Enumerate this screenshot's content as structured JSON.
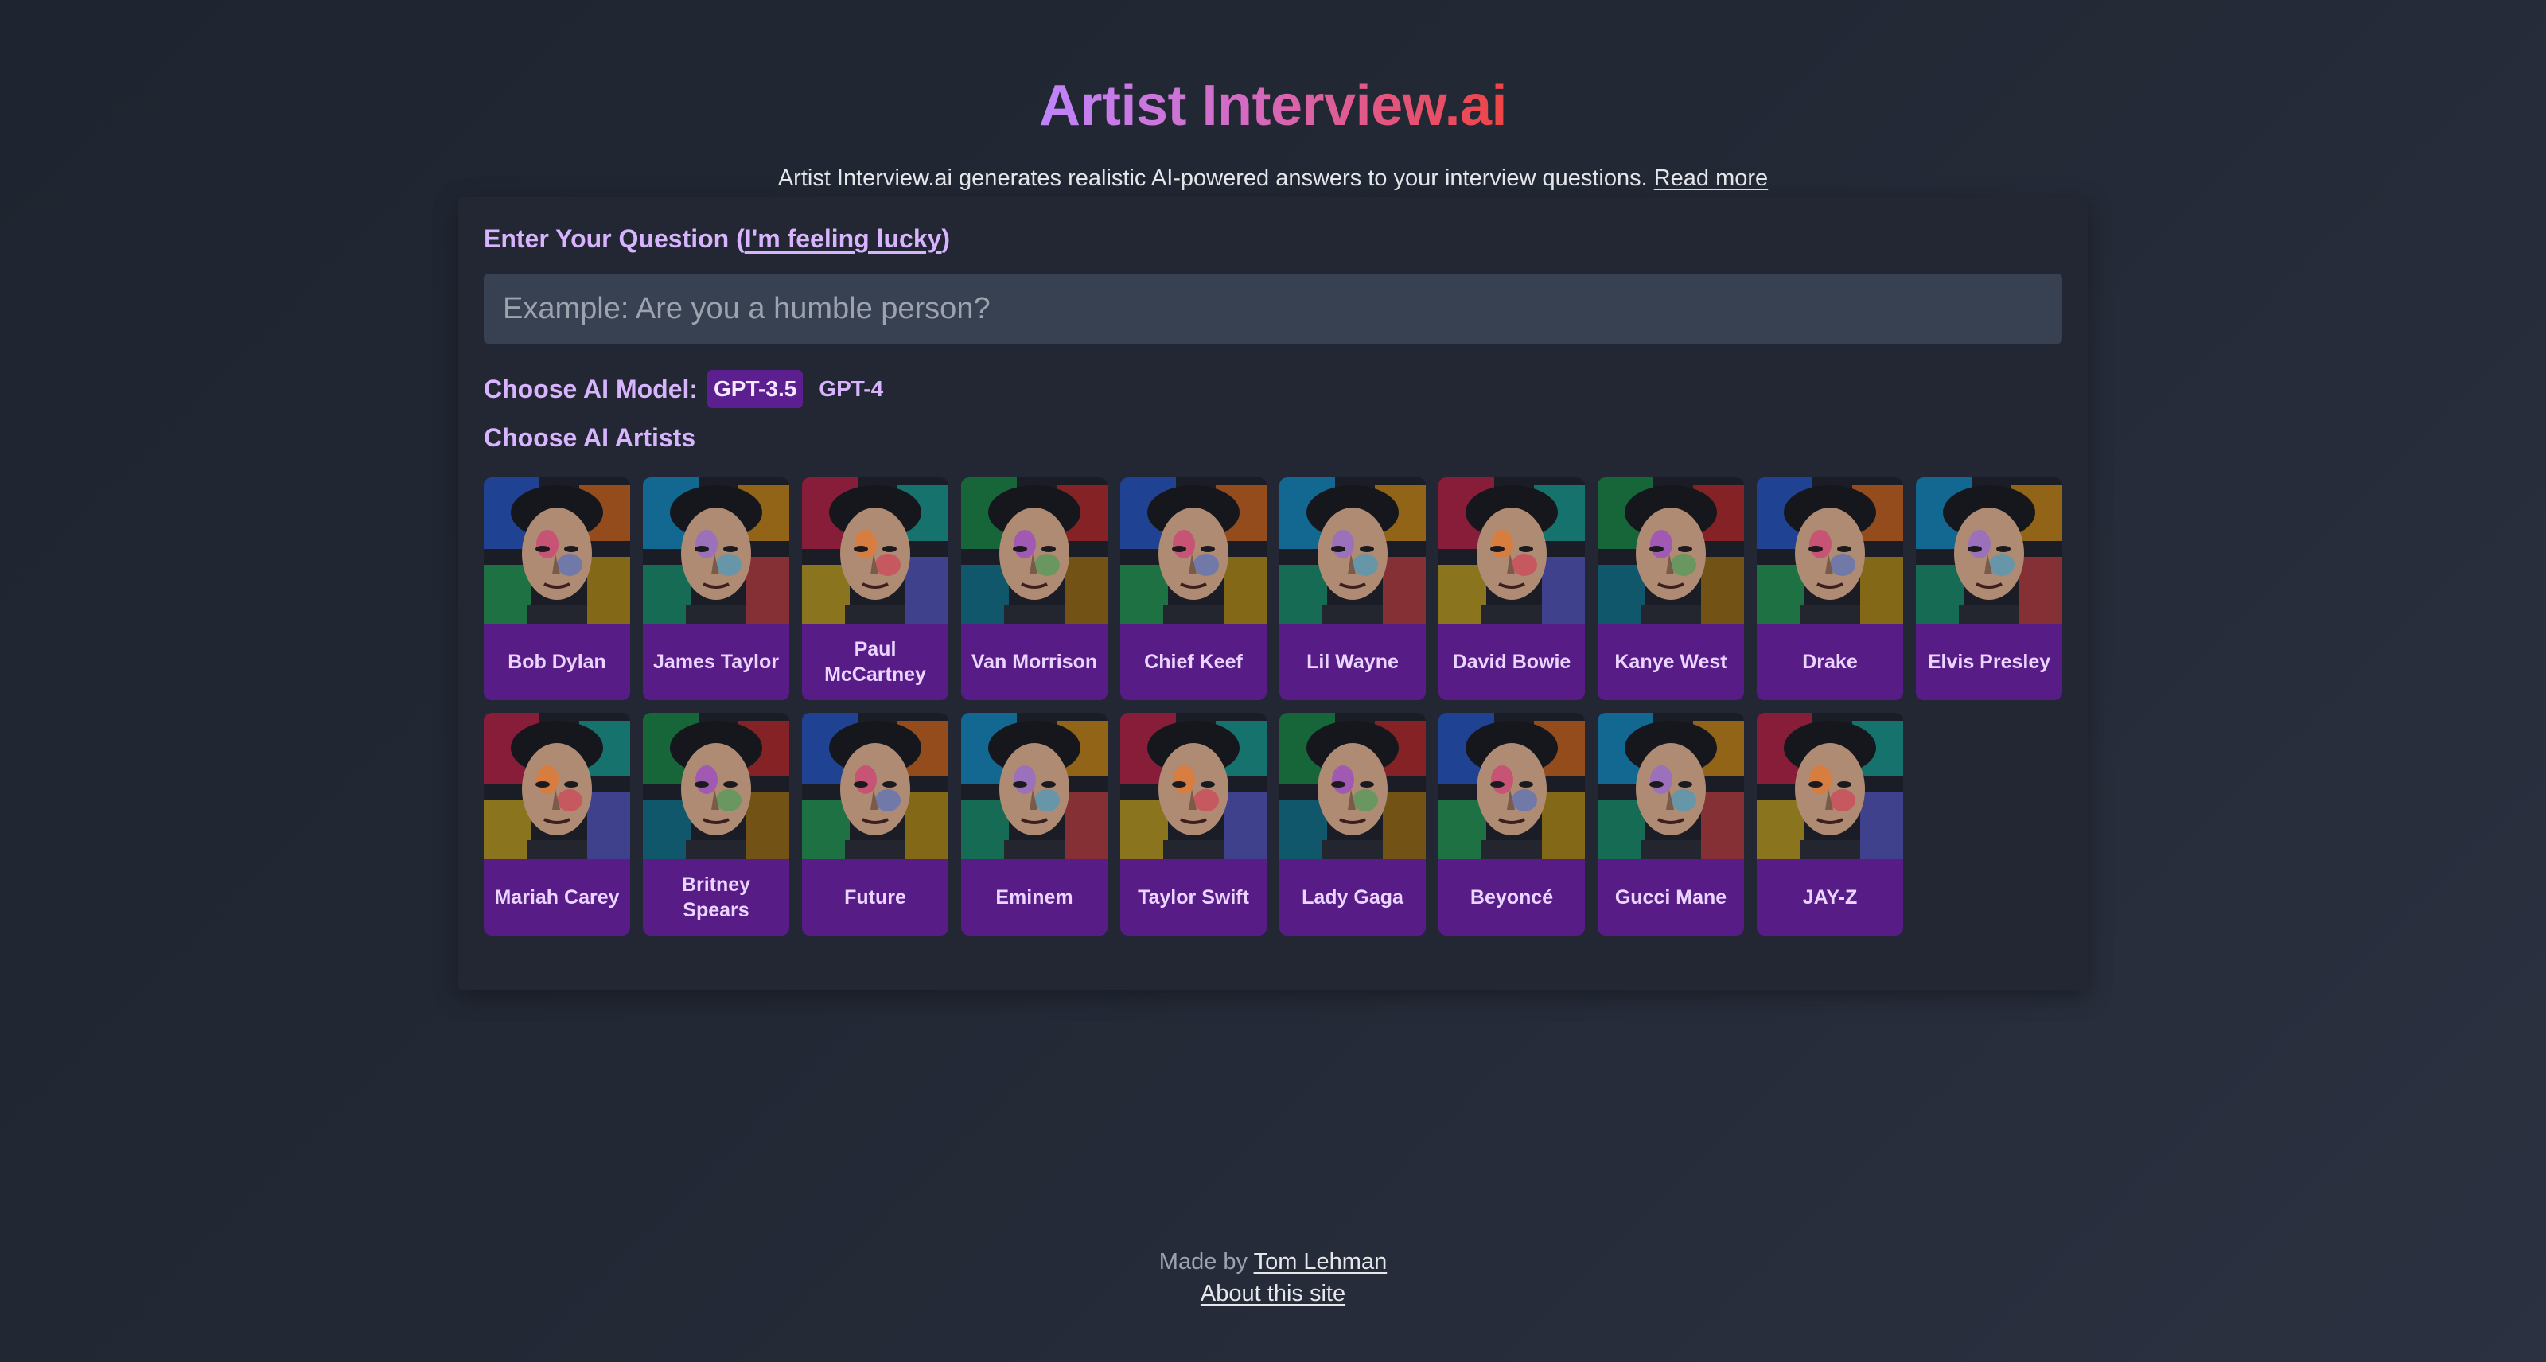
{
  "header": {
    "title": "Artist Interview.ai",
    "subtitle": "Artist Interview.ai generates realistic AI-powered answers to your interview questions.",
    "read_more": "Read more"
  },
  "question": {
    "label_prefix": "Enter Your Question (",
    "lucky_link": "I'm feeling lucky",
    "label_suffix": ")",
    "placeholder": "Example: Are you a humble person?",
    "value": ""
  },
  "model": {
    "label": "Choose AI Model:",
    "options": [
      "GPT-3.5",
      "GPT-4"
    ],
    "selected": "GPT-3.5"
  },
  "artists": {
    "label": "Choose AI Artists",
    "items": [
      {
        "name": "Bob Dylan",
        "icon": "portrait-bob-dylan"
      },
      {
        "name": "James Taylor",
        "icon": "portrait-james-taylor"
      },
      {
        "name": "Paul McCartney",
        "icon": "portrait-paul-mccartney"
      },
      {
        "name": "Van Morrison",
        "icon": "portrait-van-morrison"
      },
      {
        "name": "Chief Keef",
        "icon": "portrait-chief-keef"
      },
      {
        "name": "Lil Wayne",
        "icon": "portrait-lil-wayne"
      },
      {
        "name": "David Bowie",
        "icon": "portrait-david-bowie"
      },
      {
        "name": "Kanye West",
        "icon": "portrait-kanye-west"
      },
      {
        "name": "Drake",
        "icon": "portrait-drake"
      },
      {
        "name": "Elvis Presley",
        "icon": "portrait-elvis-presley"
      },
      {
        "name": "Mariah Carey",
        "icon": "portrait-mariah-carey"
      },
      {
        "name": "Britney Spears",
        "icon": "portrait-britney-spears"
      },
      {
        "name": "Future",
        "icon": "portrait-future"
      },
      {
        "name": "Eminem",
        "icon": "portrait-eminem"
      },
      {
        "name": "Taylor Swift",
        "icon": "portrait-taylor-swift"
      },
      {
        "name": "Lady Gaga",
        "icon": "portrait-lady-gaga"
      },
      {
        "name": "Beyoncé",
        "icon": "portrait-beyonce"
      },
      {
        "name": "Gucci Mane",
        "icon": "portrait-gucci-mane"
      },
      {
        "name": "JAY-Z",
        "icon": "portrait-jay-z"
      }
    ]
  },
  "footer": {
    "made_by": "Made by",
    "author": "Tom Lehman",
    "about": "About this site"
  },
  "colors": {
    "accent_purple": "#581c87",
    "label_purple": "#d8b4fe",
    "background": "#222834",
    "title_gradient_start": "#c084fc",
    "title_gradient_end": "#ef4444"
  }
}
